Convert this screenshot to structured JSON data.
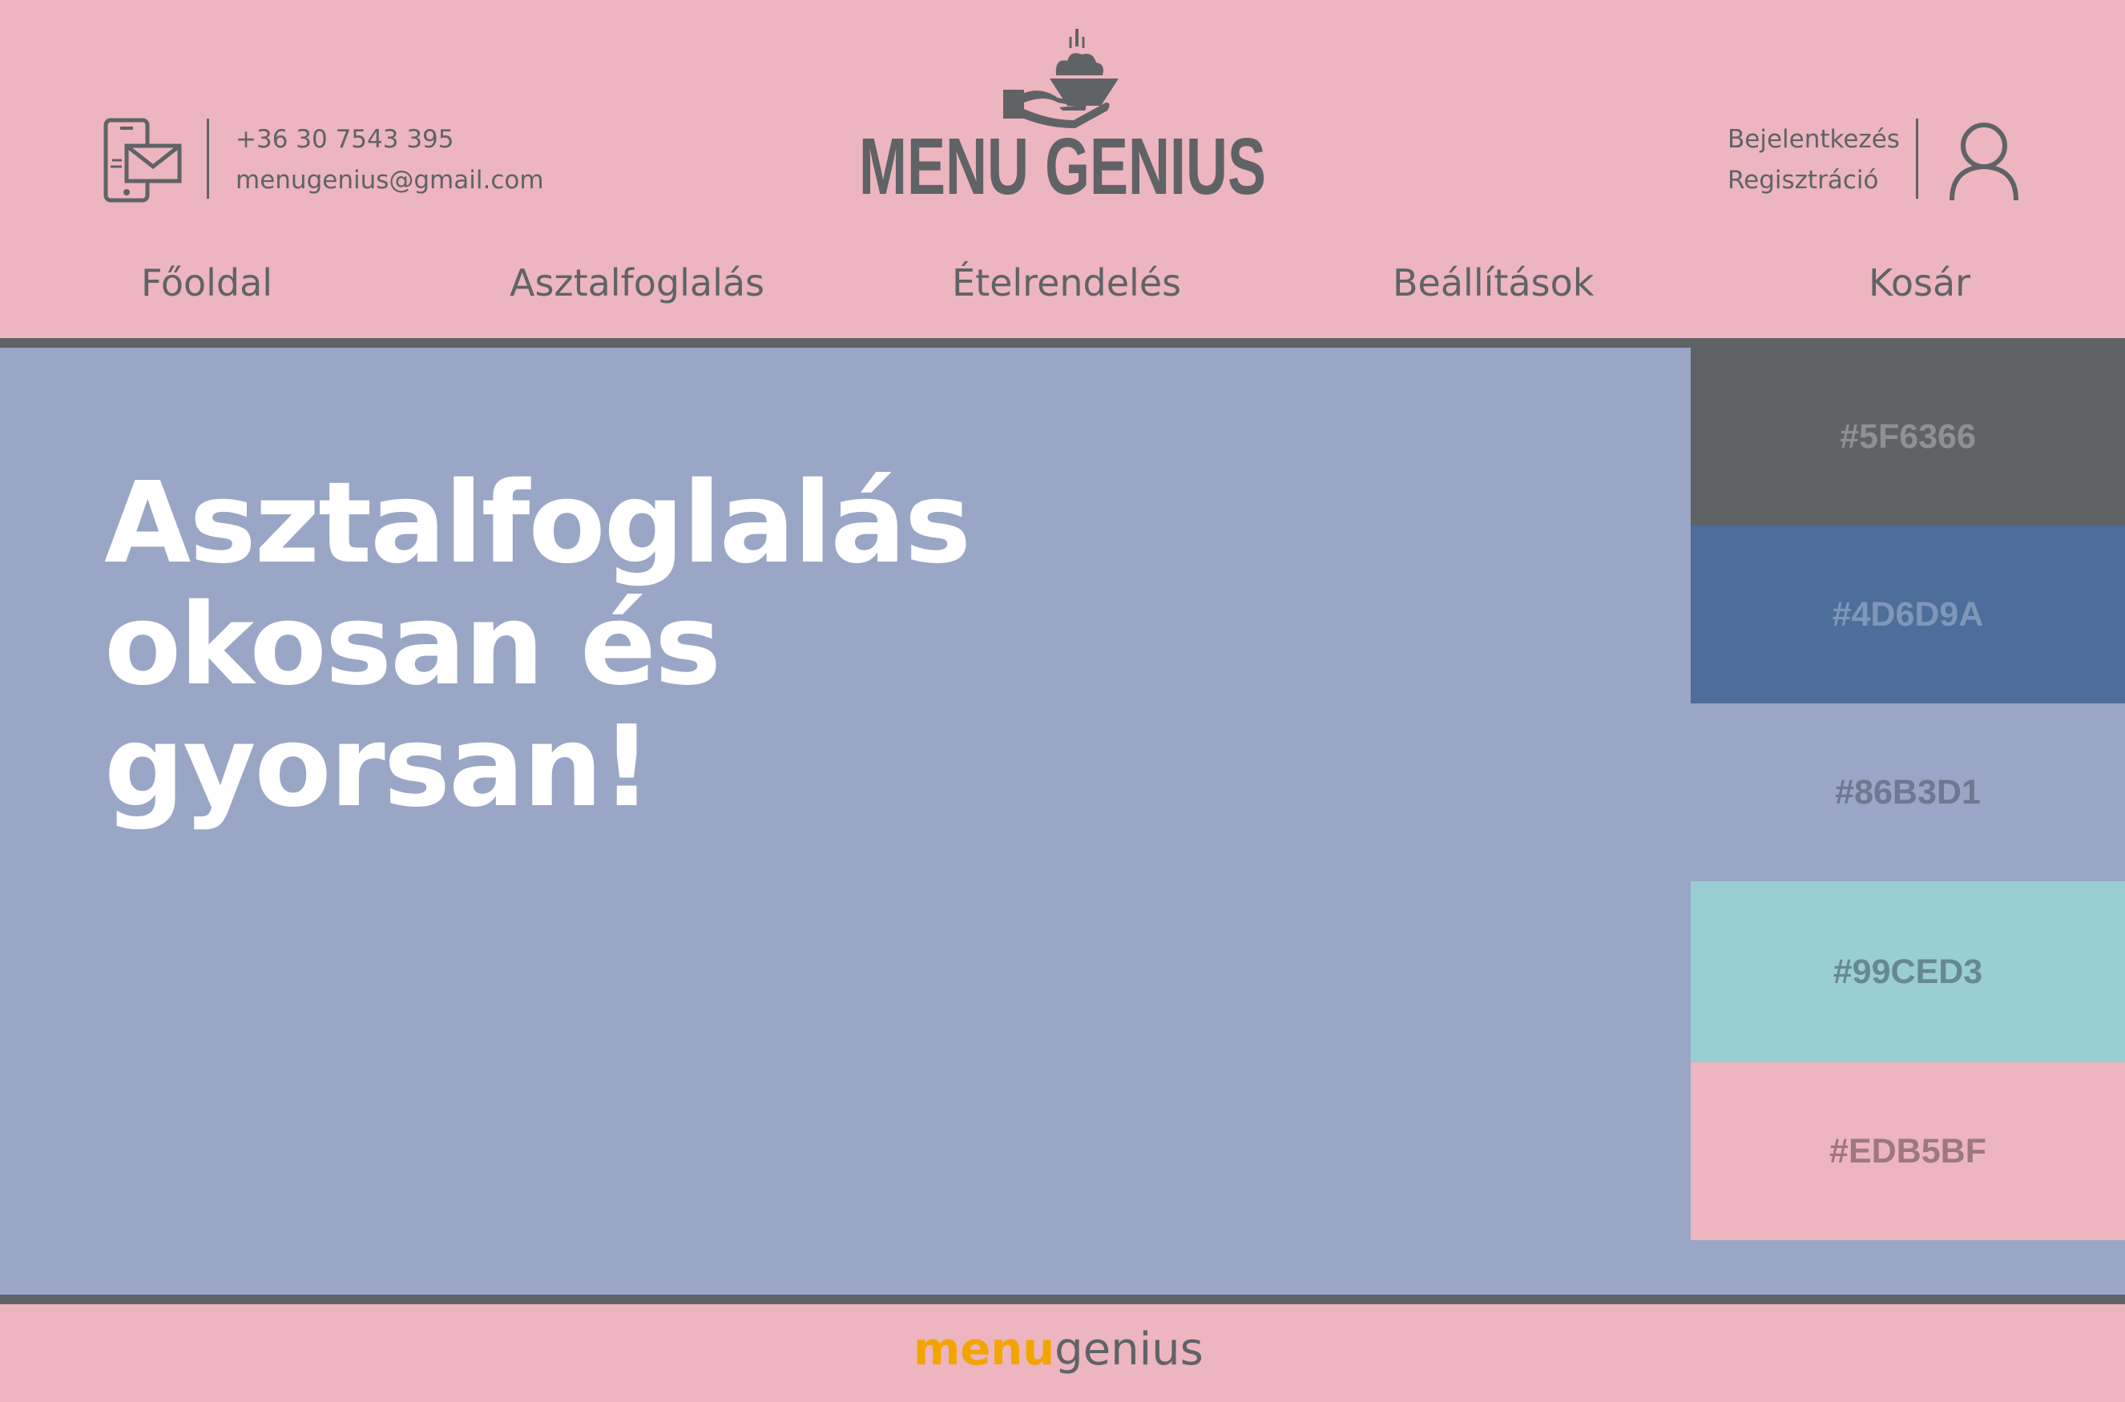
{
  "header": {
    "contact": {
      "icon": "phone-mail-icon",
      "phone": "+36 30 7543 395",
      "email": "menugenius@gmail.com"
    },
    "brand": {
      "icon": "serving-hand-icon",
      "name": "MENU GENIUS"
    },
    "auth": {
      "login_label": "Bejelentkezés",
      "register_label": "Regisztráció",
      "icon": "user-icon"
    }
  },
  "nav": {
    "items": [
      {
        "label": "Főoldal"
      },
      {
        "label": "Asztalfoglalás"
      },
      {
        "label": "Ételrendelés"
      },
      {
        "label": "Beállítások"
      },
      {
        "label": "Kosár"
      }
    ]
  },
  "hero": {
    "title_lines": [
      "Asztalfoglalás",
      "okosan és",
      "gyorsan!"
    ]
  },
  "palette": {
    "swatches": [
      {
        "hex": "#5F6366",
        "bg": "#5F6366",
        "text_color": "#8E9194"
      },
      {
        "hex": "#4D6D9A",
        "bg": "#4D6D9A",
        "text_color": "#7F97B8"
      },
      {
        "hex": "#86B3D1",
        "bg": "#99A6C5",
        "text_color": "#6E7890"
      },
      {
        "hex": "#99CED3",
        "bg": "#99CED3",
        "text_color": "#66898E"
      },
      {
        "hex": "#EDB5BF",
        "bg": "#EDB5BF",
        "text_color": "#9E7880"
      }
    ]
  },
  "footer": {
    "logo_part1": "menu",
    "logo_part2": "genius"
  },
  "colors": {
    "primary_dark": "#5F6366",
    "header_bg": "#EDB5BF",
    "hero_bg": "#99A6C5",
    "hero_text": "#FFFFFF",
    "footer_accent": "#F2A500"
  }
}
